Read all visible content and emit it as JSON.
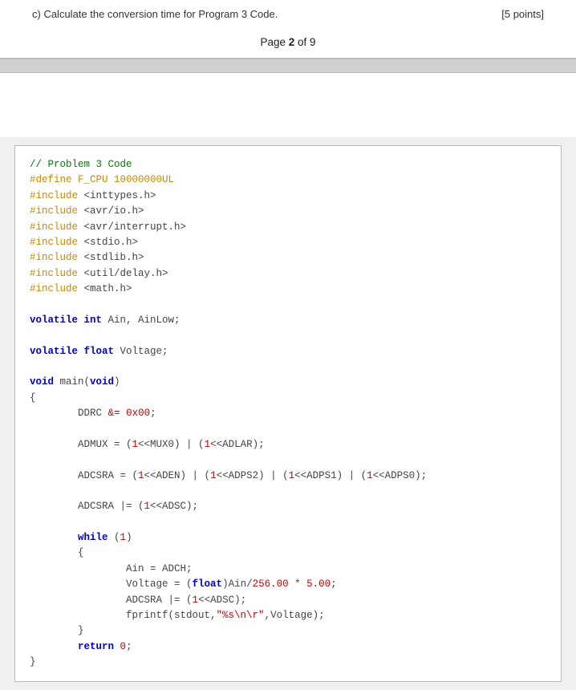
{
  "header": {
    "question": "c)   Calculate the conversion time for Program 3 Code.",
    "points": "[5 points]",
    "page_text": "Page ",
    "page_bold": "2",
    "page_of": " of 9"
  },
  "code": {
    "comment": "// Problem 3 Code",
    "define": "#define F_CPU 10000000UL",
    "includes": [
      "#include <inttypes.h>",
      "#include <avr/io.h>",
      "#include <avr/interrupt.h>",
      "#include <stdio.h>",
      "#include <stdlib.h>",
      "#include <util/delay.h>",
      "#include <math.h>"
    ],
    "volatile_int": "volatile int Ain, AinLow;",
    "volatile_float": "volatile float Voltage;",
    "main": "void main(void)",
    "body": [
      "DDRC &= 0x00;",
      "ADMUX = (1<<MUX0) | (1<<ADLAR);",
      "ADCSRA = (1<<ADEN) | (1<<ADPS2) | (1<<ADPS1) | (1<<ADPS0);",
      "ADCSRA |= (1<<ADSC);",
      "while (1)",
      "{",
      "    Ain = ADCH;",
      "    Voltage = (float)Ain/256.00 * 5.00;",
      "    ADCSRA |= (1<<ADSC);",
      "    fprintf(stdout,\"%s\\n\\r\",Voltage);",
      "}",
      "return 0;"
    ]
  }
}
